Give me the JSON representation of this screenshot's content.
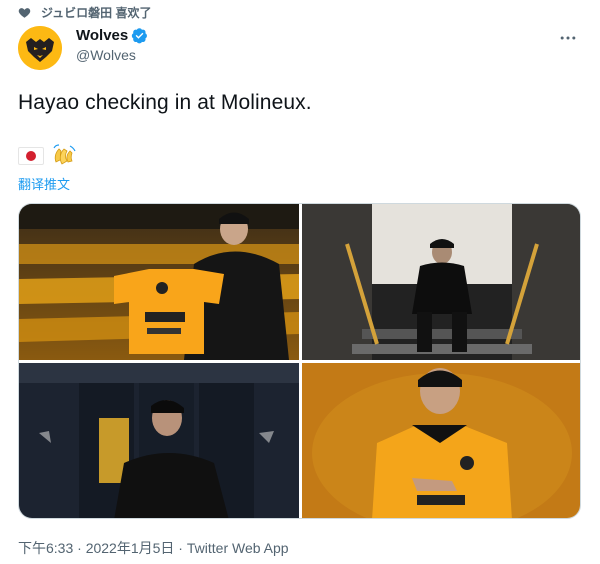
{
  "social_context": {
    "text": "ジュビロ磐田 喜欢了",
    "icon": "heart-icon"
  },
  "author": {
    "display_name": "Wolves",
    "handle": "@Wolves",
    "verified": true,
    "brand_color": "#fdb913"
  },
  "tweet": {
    "text": "Hayao checking in at Molineux.",
    "emojis": [
      "japan-flag-emoji",
      "waving-hands-emoji"
    ],
    "translate_label": "翻译推文"
  },
  "media": {
    "photos": [
      {
        "description": "Hayao holding Wolves shirt in stadium"
      },
      {
        "description": "Hayao sitting on tunnel steps"
      },
      {
        "description": "Hayao in dressing room"
      },
      {
        "description": "Hayao in Wolves kit on amber background"
      }
    ]
  },
  "meta": {
    "time": "下午6:33",
    "separator": " · ",
    "date": "2022年1月5日",
    "separator2": " · ",
    "source": "Twitter Web App"
  },
  "colors": {
    "accent": "#1d9bf0",
    "secondary_text": "#536471",
    "border": "#cfd9de"
  }
}
